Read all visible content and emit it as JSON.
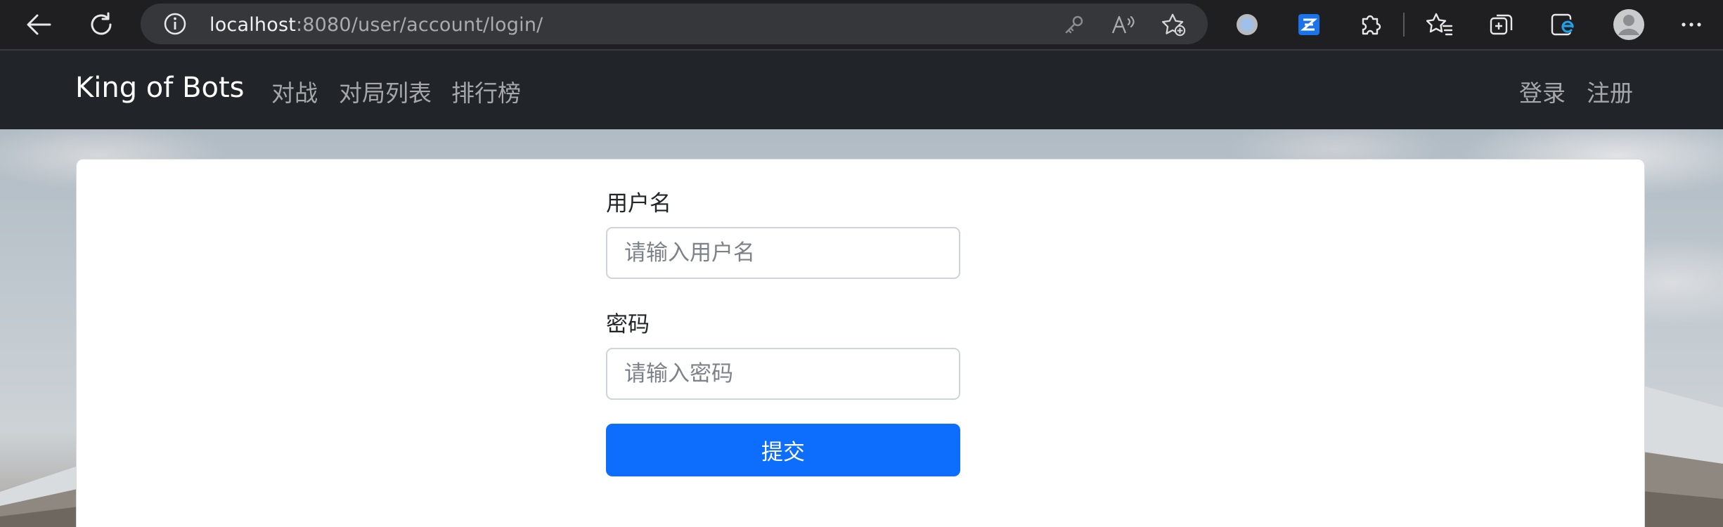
{
  "browser": {
    "url_host": "localhost",
    "url_rest": ":8080/user/account/login/",
    "icons": [
      "back-arrow-icon",
      "refresh-icon",
      "info-icon",
      "key-icon",
      "read-aloud-icon",
      "favorite-add-icon",
      "extension-circle-icon",
      "zotero-extension-icon",
      "puzzle-extensions-icon",
      "favorites-icon",
      "collections-icon",
      "edge-bar-icon",
      "profile-avatar-icon",
      "more-menu-icon"
    ]
  },
  "navbar": {
    "brand": "King of Bots",
    "links": [
      "对战",
      "对局列表",
      "排行榜"
    ],
    "login": "登录",
    "register": "注册"
  },
  "form": {
    "username_label": "用户名",
    "username_placeholder": "请输入用户名",
    "password_label": "密码",
    "password_placeholder": "请输入密码",
    "submit": "提交"
  },
  "colors": {
    "navbar_bg": "#212529",
    "primary": "#0d6efd",
    "card_bg": "#ffffff"
  }
}
